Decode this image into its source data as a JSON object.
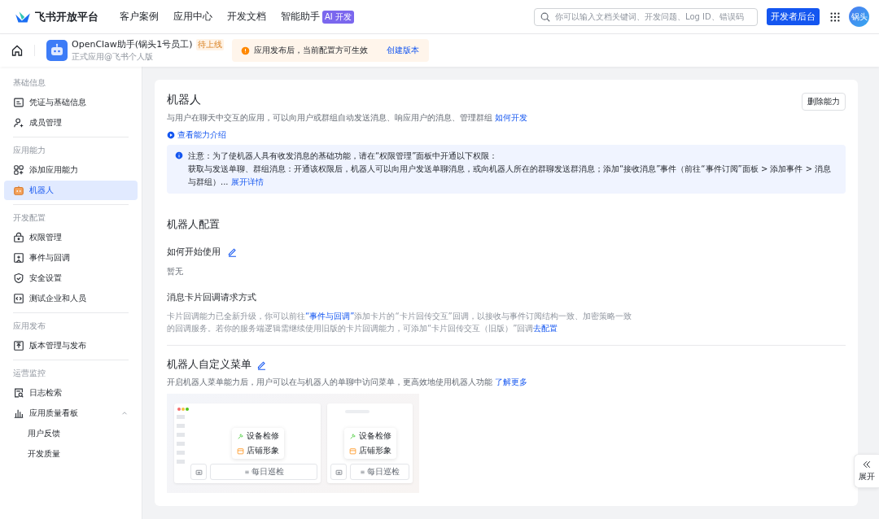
{
  "topbar": {
    "logo": "飞书开放平台",
    "nav": [
      {
        "label": "客户案例"
      },
      {
        "label": "应用中心"
      },
      {
        "label": "开发文档"
      },
      {
        "label": "智能助手",
        "badge": "AI 开发"
      }
    ],
    "search": {
      "placeholder": "你可以输入文档关键词、开发问题、Log ID、错误码"
    },
    "console_button": "开发者后台",
    "avatar": "锅头"
  },
  "app_header": {
    "app_name": "OpenClaw助手(锅头1号员工)",
    "status_tag": "待上线",
    "subtitle": "正式应用@飞书个人版",
    "notice": {
      "text": "应用发布后，当前配置方可生效",
      "link": "创建版本"
    }
  },
  "sidebar": {
    "groups": [
      {
        "title": "基础信息",
        "items": [
          {
            "label": "凭证与基础信息",
            "kind": "card",
            "selected": false
          },
          {
            "label": "成员管理",
            "kind": "member",
            "selected": false
          }
        ]
      },
      {
        "title": "应用能力",
        "items": [
          {
            "label": "添加应用能力",
            "kind": "apps",
            "selected": false
          },
          {
            "label": "机器人",
            "kind": "robot",
            "selected": true
          }
        ]
      },
      {
        "title": "开发配置",
        "items": [
          {
            "label": "权限管理",
            "kind": "lock",
            "selected": false
          },
          {
            "label": "事件与回调",
            "kind": "event",
            "selected": false
          },
          {
            "label": "安全设置",
            "kind": "shield",
            "selected": false
          },
          {
            "label": "测试企业和人员",
            "kind": "code",
            "selected": false
          }
        ]
      },
      {
        "title": "应用发布",
        "items": [
          {
            "label": "版本管理与发布",
            "kind": "upload",
            "selected": false
          }
        ]
      },
      {
        "title": "运营监控",
        "items": [
          {
            "label": "日志检索",
            "kind": "log",
            "selected": false
          },
          {
            "label": "应用质量看板",
            "kind": "chart",
            "selected": false,
            "expanded": true,
            "children": [
              {
                "label": "用户反馈",
                "selected": false
              },
              {
                "label": "开发质量",
                "selected": false
              }
            ]
          }
        ]
      }
    ]
  },
  "robot": {
    "title": "机器人",
    "delete_button": "删除能力",
    "description": "与用户在聊天中交互的应用，可以向用户或群组自动发送消息、响应用户的消息、管理群组",
    "description_link": "如何开发",
    "intro_link": "查看能力介绍",
    "alert": {
      "title": "注意：为了使机器人具有收发消息的基础功能，请在“权限管理”面板中开通以下权限：",
      "body": "获取与发送单聊、群组消息：开通该权限后，机器人可以向用户发送单聊消息，或向机器人所在的群聊发送群消息；添加“接收消息”事件（前往“事件订阅”面板 > 添加事件 > 消息与群组）...",
      "link": "展开详情"
    }
  },
  "config": {
    "title": "机器人配置",
    "sections": [
      {
        "title": "如何开始使用",
        "editable": true,
        "parts": [
          {
            "text": "暂无",
            "link": false
          }
        ],
        "kind": "value"
      },
      {
        "title": "消息卡片回调请求方式",
        "editable": false,
        "kind": "description",
        "parts": [
          {
            "text": "卡片回调能力已全新升级，你可以前往",
            "link": false
          },
          {
            "text": "“事件与回调”",
            "link": true
          },
          {
            "text": "添加卡片的“卡片回传交互”回调，以接收与事件订阅结构一致、加密策略一致的回调服务。若你的服务端逻辑需继续使用旧版的卡片回调能力，可添加“卡片回传交互（旧版）”回调",
            "link": false
          },
          {
            "text": "去配置",
            "link": true
          }
        ]
      }
    ]
  },
  "menu": {
    "title": "机器人自定义菜单",
    "editable": true,
    "description": "开启机器人菜单能力后，用户可以在与机器人的单聊中访问菜单，更高效地使用机器人功能",
    "link": "了解更多",
    "mockups": [
      {
        "kind": "desktop",
        "menu_items": [
          "设备检修",
          "店铺形象"
        ],
        "bottom_button": "每日巡检"
      },
      {
        "kind": "mobile",
        "menu_items": [
          "设备检修",
          "店铺形象"
        ],
        "bottom_button": "每日巡检"
      }
    ]
  },
  "expand_tab": {
    "label": "展开"
  }
}
